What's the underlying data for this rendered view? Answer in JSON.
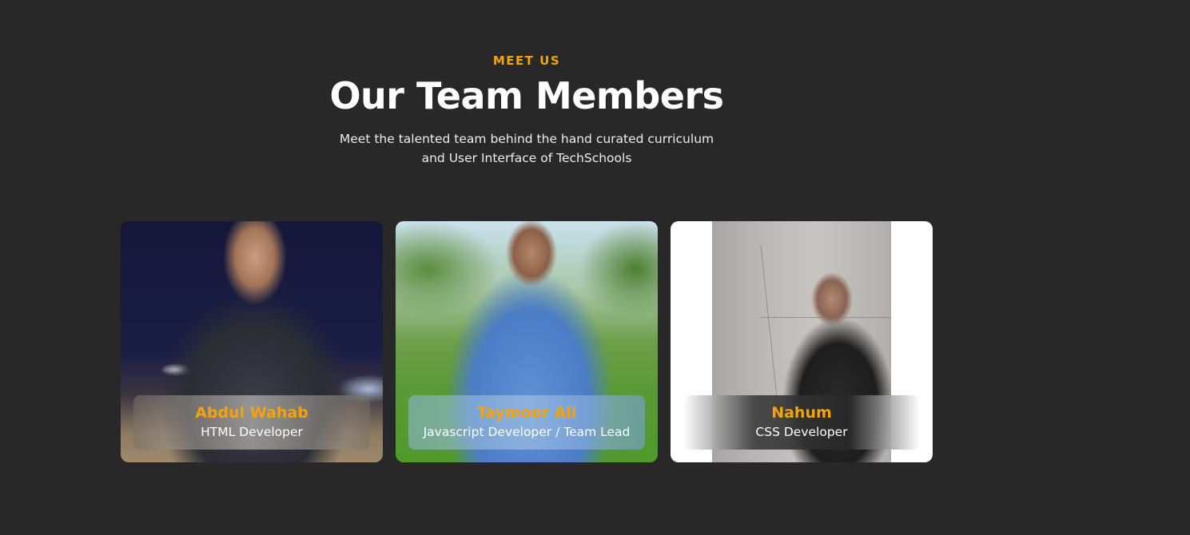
{
  "section": {
    "eyebrow": "MEET US",
    "title": "Our Team Members",
    "subtitle_line1": "Meet the talented team behind the hand curated curriculum",
    "subtitle_line2": "and User Interface of TechSchools"
  },
  "team": [
    {
      "name": "Abdul Wahab",
      "role": "HTML Developer"
    },
    {
      "name": "Taymoor Ali",
      "role": "Javascript Developer / Team Lead"
    },
    {
      "name": "Nahum",
      "role": "CSS Developer"
    }
  ],
  "colors": {
    "background": "#282828",
    "accent": "#f5a30c",
    "text": "#ffffff"
  }
}
